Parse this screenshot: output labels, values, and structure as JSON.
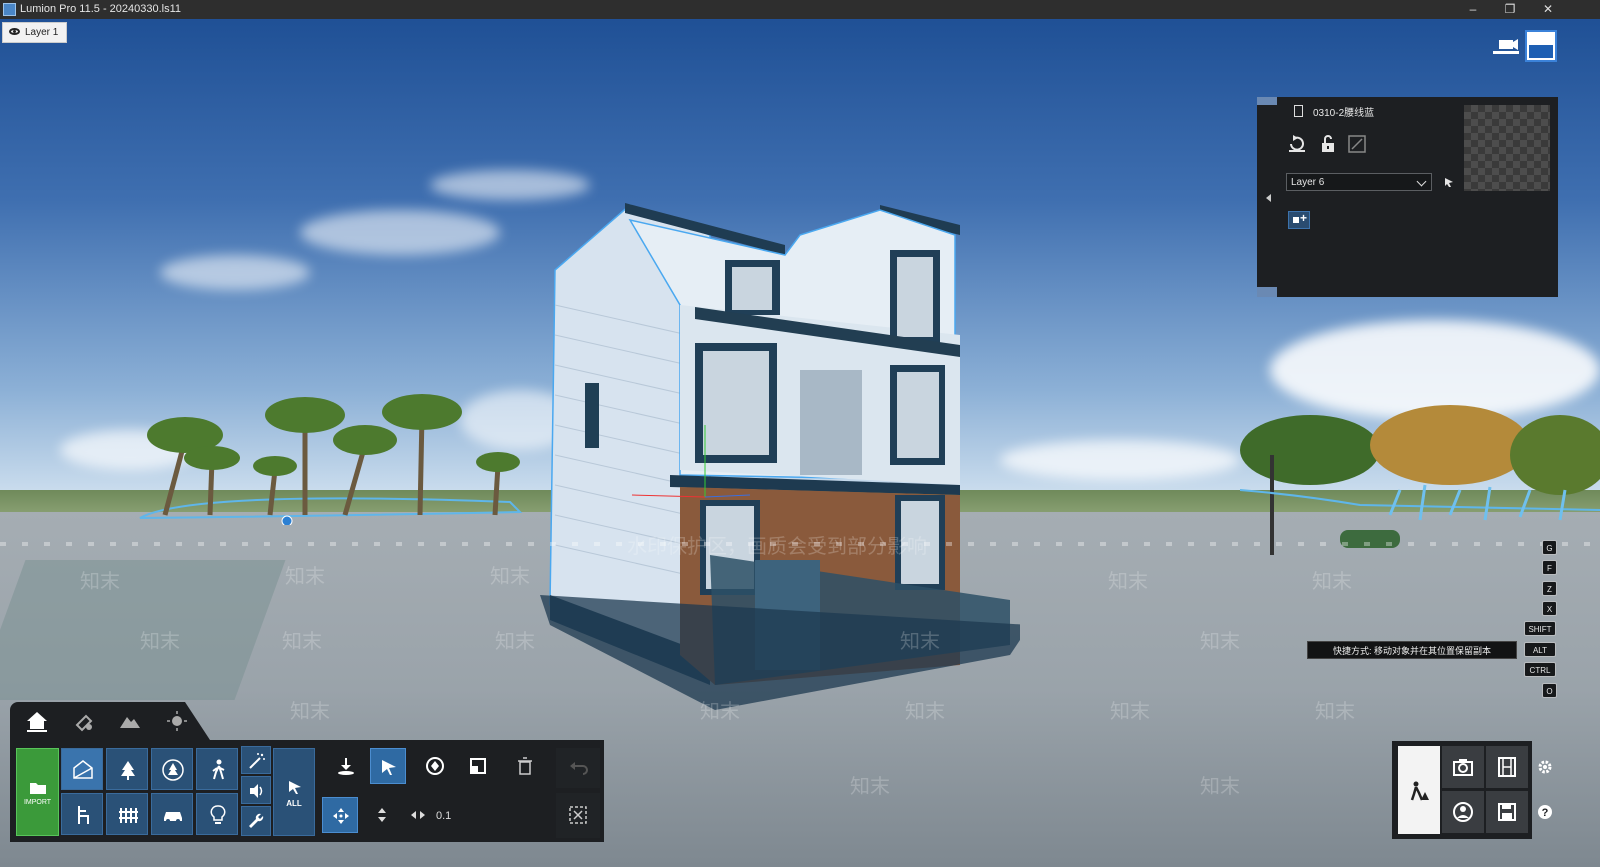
{
  "window": {
    "title": "Lumion Pro 11.5  - 20240330.ls11",
    "minimize": "–",
    "restore": "❐",
    "close": "✕"
  },
  "layer_tab": {
    "label": "Layer 1"
  },
  "properties": {
    "object_name": "0310-2腰线蓝",
    "layer_select": "Layer 6"
  },
  "shortcut_keys": [
    "G",
    "F",
    "Z",
    "X",
    "SHIFT",
    "ALT",
    "CTRL",
    "O"
  ],
  "hint": {
    "text": "快捷方式:  移动对象并在其位置保留副本"
  },
  "watermark": {
    "banner": "水印保护区，画质会受到部分影响",
    "tile": "知末"
  },
  "toolbar": {
    "import_label": "IMPORT",
    "all_label": "ALL",
    "value": "0.1"
  },
  "colors": {
    "accent": "#3b82d9",
    "panel": "#1d1f22",
    "import_green": "#3b9a3a",
    "button_blue": "#2a5177"
  }
}
